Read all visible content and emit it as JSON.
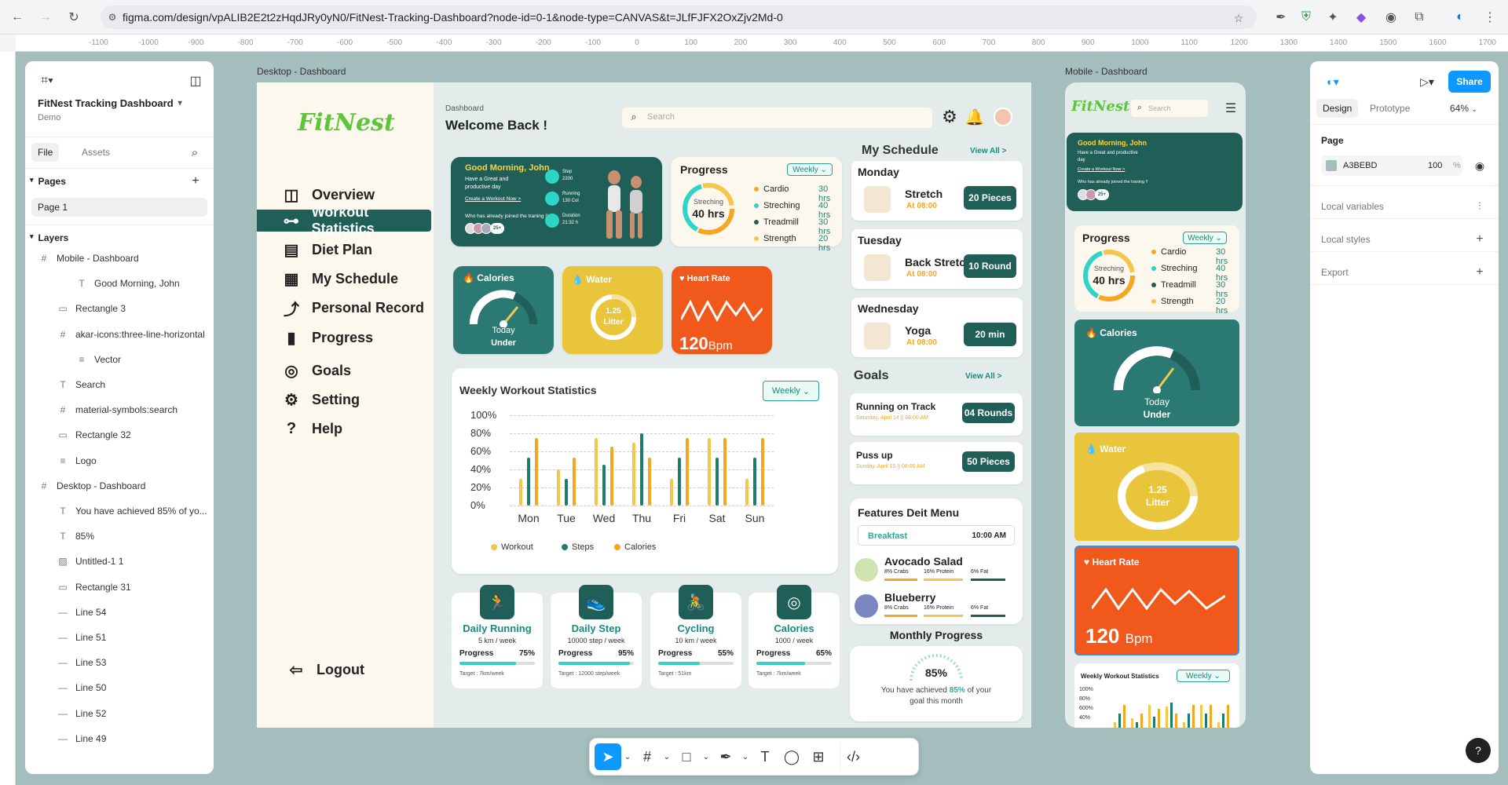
{
  "browser": {
    "url": "figma.com/design/vpALIB2E2t2zHqdJRy0yN0/FitNest-Tracking-Dashboard?node-id=0-1&node-type=CANVAS&t=JLfFJFX2OxZjv2Md-0"
  },
  "ruler": {
    "ticks": [
      "-1100",
      "-1000",
      "-900",
      "-800",
      "-700",
      "-600",
      "-500",
      "-400",
      "-300",
      "-200",
      "-100",
      "0",
      "100",
      "200",
      "300",
      "400",
      "500",
      "600",
      "700",
      "800",
      "900",
      "1000",
      "1100",
      "1200",
      "1300",
      "1400",
      "1500",
      "1600",
      "1700"
    ]
  },
  "file": {
    "name": "FitNest Tracking Dashboard",
    "team": "Demo",
    "tab_file": "File",
    "tab_assets": "Assets",
    "pages_label": "Pages",
    "page1": "Page 1",
    "layers_label": "Layers"
  },
  "layers": [
    {
      "name": "Mobile - Dashboard",
      "icon": "#",
      "indent": 0
    },
    {
      "name": "Good Morning, John",
      "icon": "T",
      "indent": 2
    },
    {
      "name": "Rectangle 3",
      "icon": "▭",
      "indent": 1
    },
    {
      "name": "akar-icons:three-line-horizontal",
      "icon": "#",
      "indent": 1
    },
    {
      "name": "Vector",
      "icon": "≡",
      "indent": 2
    },
    {
      "name": "Search",
      "icon": "T",
      "indent": 1
    },
    {
      "name": "material-symbols:search",
      "icon": "#",
      "indent": 1
    },
    {
      "name": "Rectangle 32",
      "icon": "▭",
      "indent": 1
    },
    {
      "name": "Logo",
      "icon": "≡",
      "indent": 1
    },
    {
      "name": "Desktop - Dashboard",
      "icon": "#",
      "indent": 0
    },
    {
      "name": "You have achieved 85% of yo...",
      "icon": "T",
      "indent": 1
    },
    {
      "name": "85%",
      "icon": "T",
      "indent": 1
    },
    {
      "name": "Untitled-1 1",
      "icon": "▨",
      "indent": 1
    },
    {
      "name": "Rectangle 31",
      "icon": "▭",
      "indent": 1
    },
    {
      "name": "Line 54",
      "icon": "—",
      "indent": 1
    },
    {
      "name": "Line 51",
      "icon": "—",
      "indent": 1
    },
    {
      "name": "Line 53",
      "icon": "—",
      "indent": 1
    },
    {
      "name": "Line 50",
      "icon": "—",
      "indent": 1
    },
    {
      "name": "Line 52",
      "icon": "—",
      "indent": 1
    },
    {
      "name": "Line 49",
      "icon": "—",
      "indent": 1
    }
  ],
  "frames": {
    "desktop_label": "Desktop - Dashboard",
    "mobile_label": "Mobile - Dashboard"
  },
  "dashboard": {
    "logo": "FitNest",
    "crumb": "Dashboard",
    "welcome": "Welcome Back !",
    "search_placeholder": "Search",
    "nav": [
      "Overview",
      "Workout Statistics",
      "Diet Plan",
      "My Schedule",
      "Personal Record",
      "Progress",
      "Goals",
      "Setting",
      "Help"
    ],
    "logout": "Logout",
    "greeting": {
      "title": "Good Morning, John",
      "text": "Have a Great and productive day",
      "link": "Create a Workout Now >",
      "joined": "Who has already joined the traning !!",
      "more": "25+",
      "stats": [
        {
          "label": "Step",
          "value": "2200"
        },
        {
          "label": "Running",
          "value": "130 Col"
        },
        {
          "label": "Duration",
          "value": "21:32 h"
        }
      ]
    },
    "progress": {
      "title": "Progress",
      "period": "Weekly",
      "center_label": "Streching",
      "center_value": "40 hrs",
      "items": [
        {
          "name": "Cardio",
          "value": "30 hrs",
          "color": "#f5a623"
        },
        {
          "name": "Streching",
          "value": "40 hrs",
          "color": "#2ed4c6"
        },
        {
          "name": "Treadmill",
          "value": "30 hrs",
          "color": "#1f5f58"
        },
        {
          "name": "Strength",
          "value": "20 hrs",
          "color": "#f5c64a"
        }
      ]
    },
    "calories": {
      "title": "Calories",
      "label1": "Today",
      "label2": "Under"
    },
    "water": {
      "title": "Water",
      "amount": "1.25",
      "unit": "Litter"
    },
    "heart": {
      "title": "Heart Rate",
      "value": "120",
      "unit": "Bpm"
    },
    "weekly": {
      "title": "Weekly Workout Statistics",
      "period": "Weekly"
    },
    "activities": [
      {
        "title": "Daily Running",
        "sub": "5 km / week",
        "progress_label": "Progress",
        "pct": "75%",
        "fill": 0.75,
        "target": "Target : 7km/week",
        "icon": "🏃"
      },
      {
        "title": "Daily Step",
        "sub": "10000 step / week",
        "progress_label": "Progress",
        "pct": "95%",
        "fill": 0.95,
        "target": "Target : 12000 step/week",
        "icon": "👟"
      },
      {
        "title": "Cycling",
        "sub": "10 km / week",
        "progress_label": "Progress",
        "pct": "55%",
        "fill": 0.55,
        "target": "Target : 51km",
        "icon": "🚴"
      },
      {
        "title": "Calories",
        "sub": "1000 / week",
        "progress_label": "Progress",
        "pct": "65%",
        "fill": 0.65,
        "target": "Target : 7km/week",
        "icon": "◎"
      }
    ],
    "schedule": {
      "title": "My Schedule",
      "view_all": "View All >",
      "items": [
        {
          "day": "Monday",
          "name": "Stretch",
          "time": "At 08:00",
          "badge": "20 Pieces"
        },
        {
          "day": "Tuesday",
          "name": "Back Stretch",
          "time": "At 08:00",
          "badge": "10 Round"
        },
        {
          "day": "Wednesday",
          "name": "Yoga",
          "time": "At 08:00",
          "badge": "20 min"
        }
      ]
    },
    "goals": {
      "title": "Goals",
      "view_all": "View All >",
      "items": [
        {
          "name": "Running on Track",
          "date": "Saturday, April 14 || 08:00 AM",
          "badge": "04 Rounds"
        },
        {
          "name": "Puss up",
          "date": "Sunday, April 15 || 08:00 AM",
          "badge": "50 Pieces"
        }
      ]
    },
    "diet": {
      "title": "Features Deit Menu",
      "meal": "Breakfast",
      "meal_time": "10:00 AM",
      "items": [
        {
          "name": "Avocado Salad",
          "carbs": "8% Crabs",
          "protein": "16% Protein",
          "fat": "6% Fat"
        },
        {
          "name": "Blueberry",
          "carbs": "8% Crabs",
          "protein": "16% Protein",
          "fat": "6% Fat"
        }
      ]
    },
    "monthly": {
      "title": "Monthly Progress",
      "pct": "85%",
      "text1": "You have achieved ",
      "text_pct": "85%",
      "text2": " of your goal this month"
    }
  },
  "mobile": {
    "search_placeholder": "Search",
    "weekly_title": "Weekly Workout Statistics",
    "weekly_period": "Weekly",
    "ylabels": [
      "100%",
      "80%",
      "600%",
      "40%"
    ]
  },
  "right_panel": {
    "tab_design": "Design",
    "tab_prototype": "Prototype",
    "zoom": "64%",
    "share": "Share",
    "page_label": "Page",
    "color_hex": "A3BEBD",
    "opacity": "100",
    "opacity_unit": "%",
    "local_variables": "Local variables",
    "local_styles": "Local styles",
    "export": "Export"
  },
  "colors": {
    "canvas": "#a3bebd",
    "teal": "#2a7a73",
    "dark_teal": "#1f5f58",
    "yellow": "#e8c53a",
    "orange": "#f0581c",
    "figma_blue": "#0d99ff"
  },
  "chart_data": {
    "type": "bar",
    "title": "Weekly Workout Statistics",
    "categories": [
      "Mon",
      "Tue",
      "Wed",
      "Thu",
      "Fri",
      "Sat",
      "Sun"
    ],
    "ylim": [
      0,
      100
    ],
    "yticks": [
      "100%",
      "80%",
      "60%",
      "40%",
      "20%",
      "0%"
    ],
    "series": [
      {
        "name": "Workout",
        "color": "#f5c64a",
        "values": [
          30,
          40,
          75,
          70,
          30,
          75,
          30
        ]
      },
      {
        "name": "Steps",
        "color": "#1f7a70",
        "values": [
          53,
          30,
          45,
          80,
          53,
          53,
          53
        ]
      },
      {
        "name": "Calories",
        "color": "#f5a623",
        "values": [
          75,
          53,
          65,
          53,
          75,
          75,
          75
        ]
      }
    ],
    "legend": "bottom"
  }
}
